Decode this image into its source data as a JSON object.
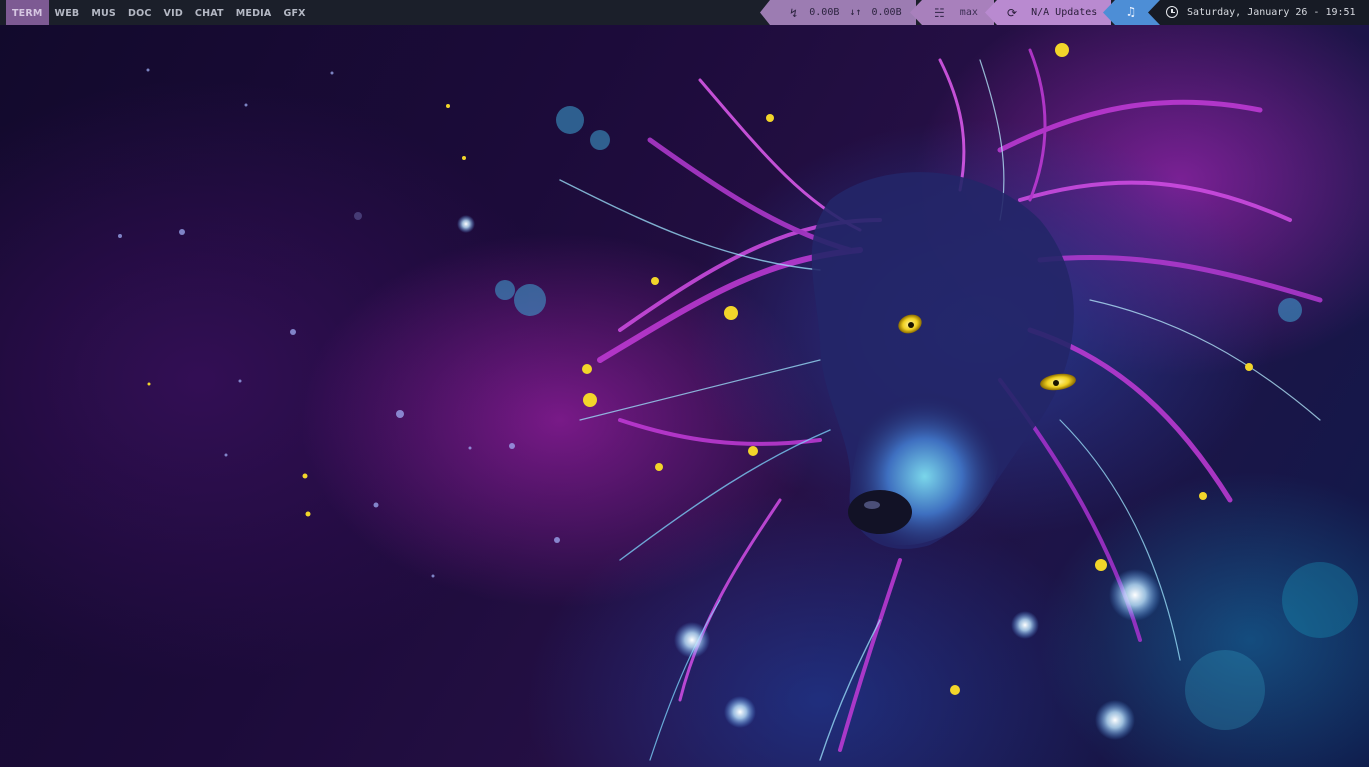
{
  "workspaces": [
    {
      "label": "TERM",
      "active": true
    },
    {
      "label": "WEB",
      "active": false
    },
    {
      "label": "MUS",
      "active": false
    },
    {
      "label": "DOC",
      "active": false
    },
    {
      "label": "VID",
      "active": false
    },
    {
      "label": "CHAT",
      "active": false
    },
    {
      "label": "MEDIA",
      "active": false
    },
    {
      "label": "GFX",
      "active": false
    }
  ],
  "network": {
    "icon": "network-icon",
    "glyph": "↯",
    "down": "0.00B",
    "arrows": "↓↑",
    "up": "0.00B"
  },
  "volume": {
    "icon": "volume-mixer-icon",
    "glyph": "☵",
    "level": "max"
  },
  "updates": {
    "icon": "refresh-icon",
    "glyph": "⟳",
    "text": "N/A Updates"
  },
  "music": {
    "icon": "music-note-icon",
    "glyph": "♫"
  },
  "clock": {
    "icon": "clock-icon",
    "text": "Saturday, January 26 - 19:51"
  },
  "colors": {
    "bar_bg": "#1b1f2a",
    "active_workspace": "#7d5a93",
    "network_segment": "#9c7cb2",
    "volume_segment": "#a880bc",
    "updates_segment": "#b98ad0",
    "music_segment": "#4d8ed6",
    "clock_segment": "#171b25"
  }
}
